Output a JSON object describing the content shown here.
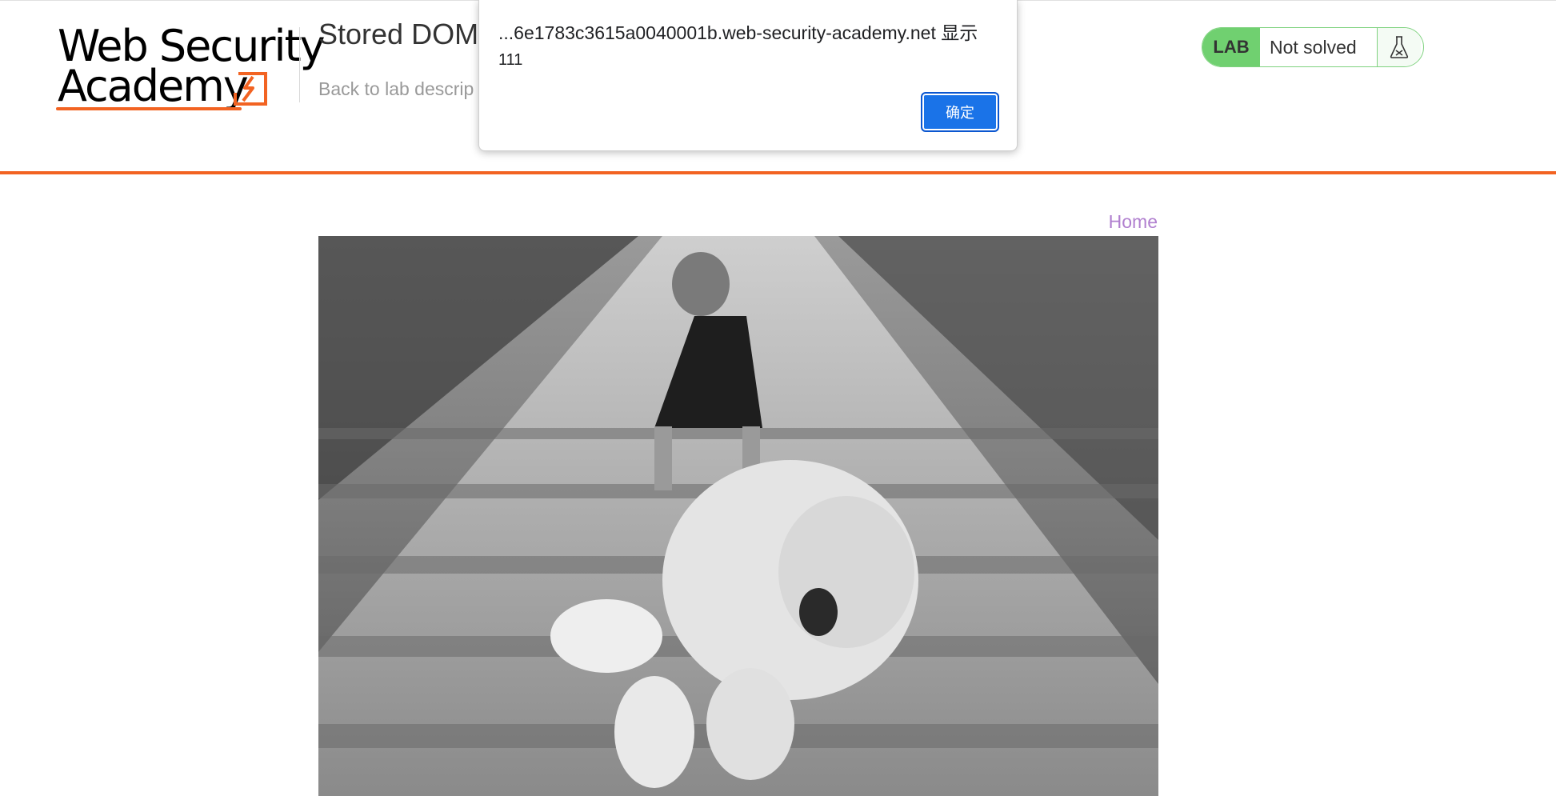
{
  "header": {
    "logo_line1": "Web Security",
    "logo_line2": "Academy",
    "lab_title": "Stored DOM",
    "back_link": "Back to lab descrip"
  },
  "status": {
    "badge": "LAB",
    "text": "Not solved",
    "icon": "flask-icon"
  },
  "nav": {
    "home": "Home"
  },
  "dialog": {
    "origin": "...6e1783c3615a0040001b.web-security-academy.net 显示",
    "message": "111",
    "ok_label": "确定"
  },
  "colors": {
    "accent_orange": "#f26322",
    "lab_green": "#70d070",
    "link_purple": "#b07fcf",
    "dialog_button": "#1a73e8"
  }
}
